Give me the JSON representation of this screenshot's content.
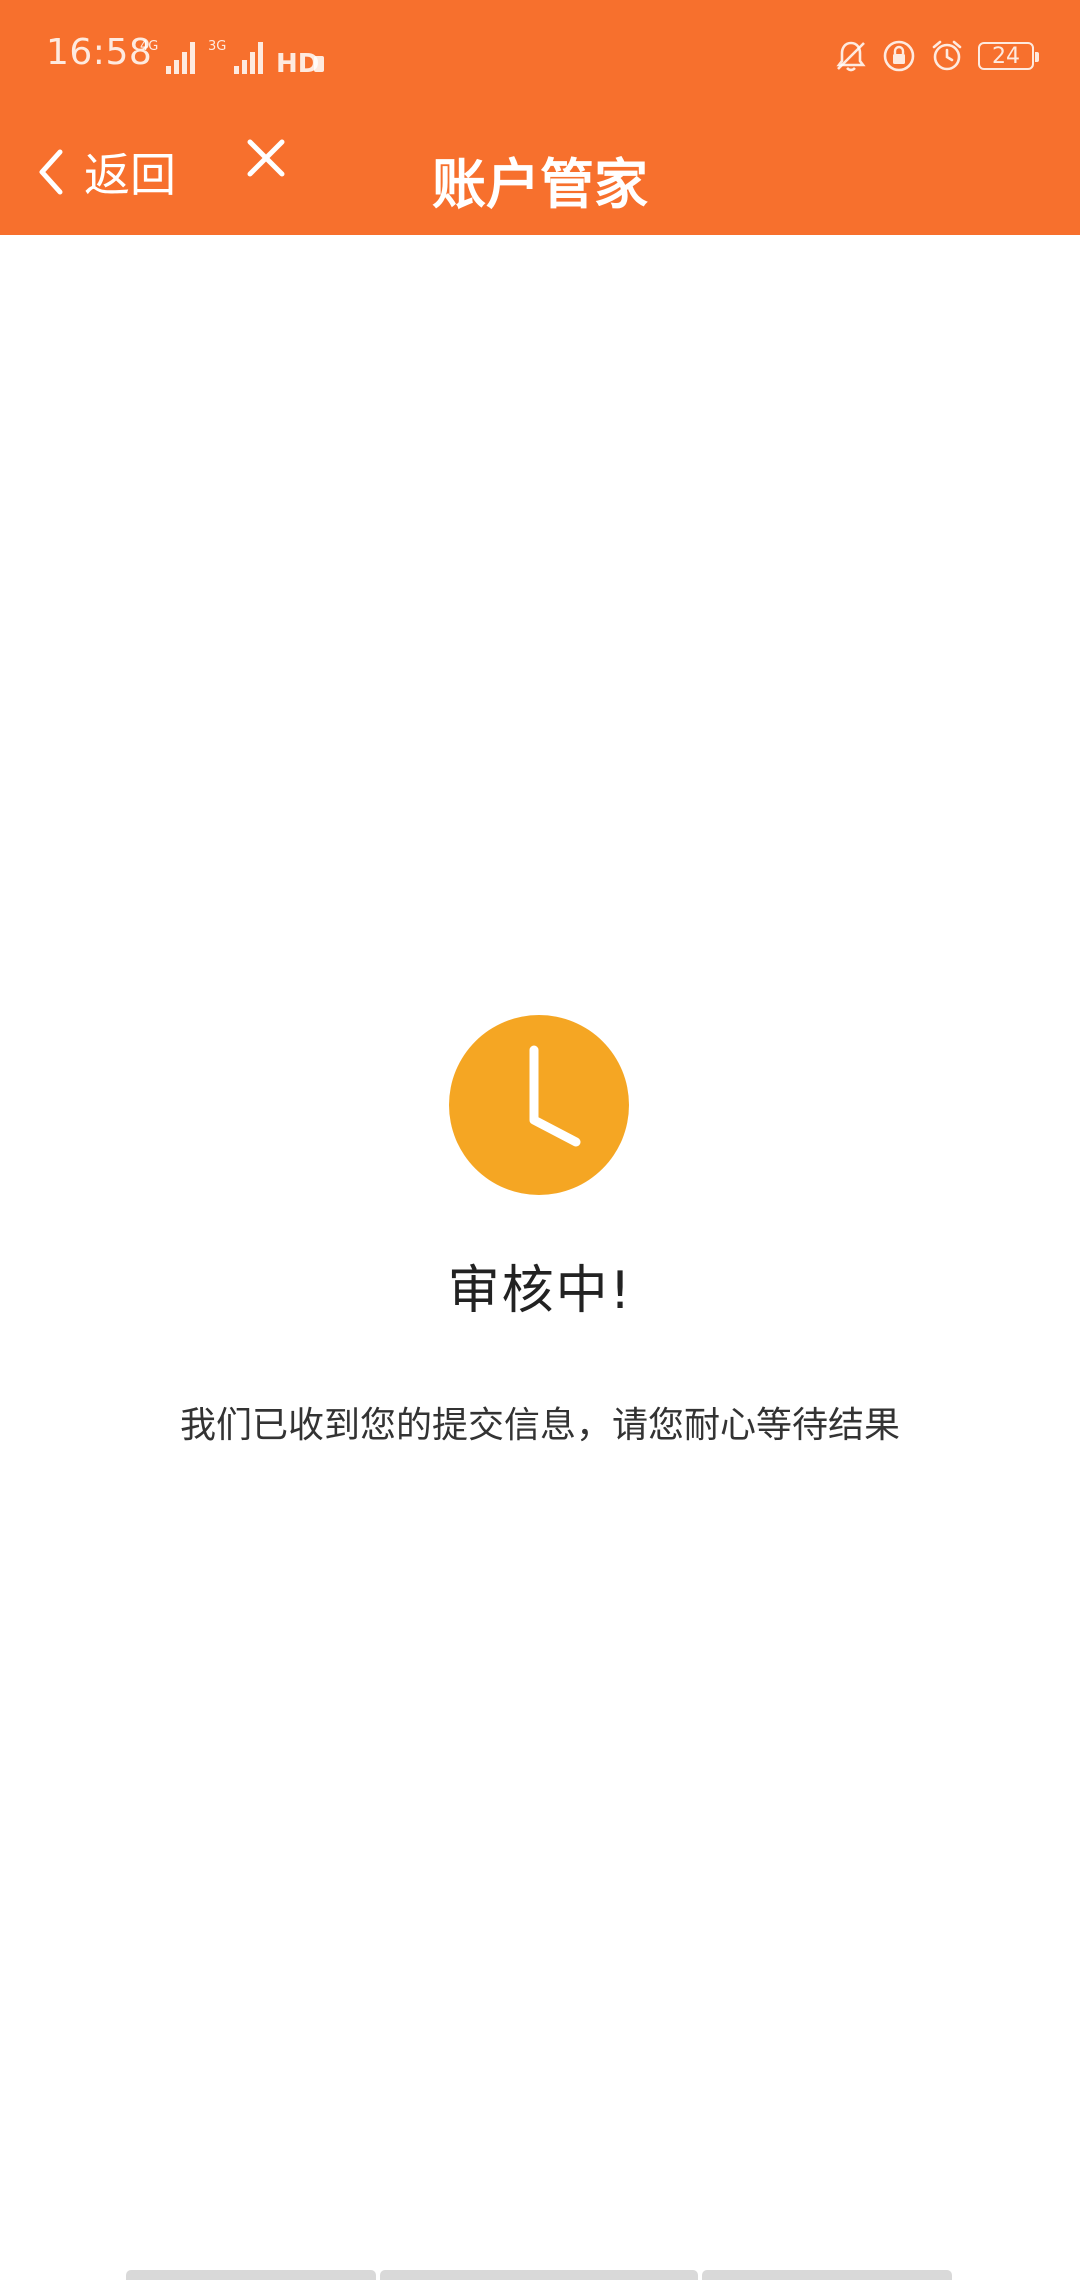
{
  "status_bar": {
    "time": "16:58",
    "network_1": "4G",
    "network_2": "3G",
    "hd_label": "HD",
    "battery_level": "24"
  },
  "navbar": {
    "back_label": "返回",
    "title": "账户管家"
  },
  "content": {
    "status_title": "审核中!",
    "status_message": "我们已收到您的提交信息，请您耐心等待结果"
  },
  "colors": {
    "header_bg": "#F7702D",
    "clock_bg": "#F5A623"
  },
  "icons": {
    "back": "chevron-left-icon",
    "close": "close-icon",
    "clock": "clock-icon",
    "mute": "bell-off-icon",
    "lock_rotate": "rotation-lock-icon",
    "alarm": "alarm-icon"
  }
}
